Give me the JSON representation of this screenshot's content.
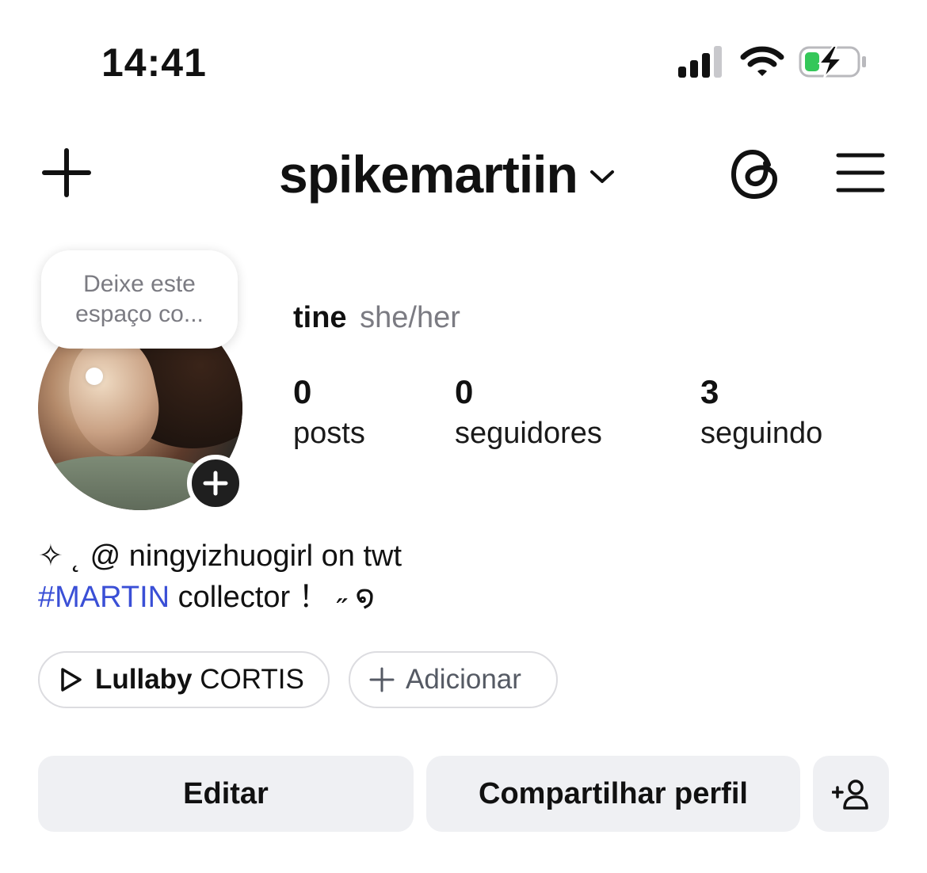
{
  "status_bar": {
    "time": "14:41",
    "signal_icon": "cellular-signal-icon",
    "wifi_icon": "wifi-icon",
    "battery_icon": "battery-charging-icon"
  },
  "header": {
    "username": "spikemartiin",
    "icons": [
      "plus-icon",
      "chevron-down-icon",
      "threads-icon",
      "menu-icon"
    ]
  },
  "note": {
    "line1": "Deixe este",
    "line2": "espaço co..."
  },
  "profile": {
    "name": "tine",
    "pronouns": "she/her",
    "stats": [
      {
        "value": "0",
        "label": "posts"
      },
      {
        "value": "0",
        "label": "seguidores"
      },
      {
        "value": "3",
        "label": "seguindo"
      }
    ]
  },
  "bio": {
    "line1": "✧  ˛ @ ningyizhuogirl on twt",
    "hashtag": "#MARTIN",
    "line2_rest": " collector ！ ˶ ໑"
  },
  "chips": {
    "music_title": "Lullaby",
    "music_artist": "CORTIS",
    "add_label": "Adicionar"
  },
  "buttons": {
    "edit": "Editar",
    "share": "Compartilhar perfil"
  },
  "colors": {
    "hashtag": "#3a4fd6",
    "button_bg": "#eff0f3",
    "battery_green": "#34c759"
  }
}
